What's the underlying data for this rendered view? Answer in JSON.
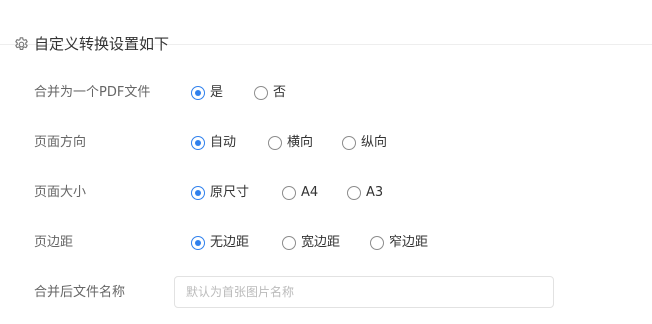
{
  "section": {
    "title": "自定义转换设置如下",
    "icon": "gear-icon"
  },
  "settings": {
    "merge": {
      "label": "合并为一个PDF文件",
      "options": [
        "是",
        "否"
      ],
      "selected": "是"
    },
    "orientation": {
      "label": "页面方向",
      "options": [
        "自动",
        "横向",
        "纵向"
      ],
      "selected": "自动"
    },
    "page_size": {
      "label": "页面大小",
      "options": [
        "原尺寸",
        "A4",
        "A3"
      ],
      "selected": "原尺寸"
    },
    "margin": {
      "label": "页边距",
      "options": [
        "无边距",
        "宽边距",
        "窄边距"
      ],
      "selected": "无边距"
    },
    "filename": {
      "label": "合并后文件名称",
      "value": "",
      "placeholder": "默认为首张图片名称"
    }
  },
  "colors": {
    "accent": "#2f80ed",
    "label_text": "#666666",
    "option_text": "#333333"
  }
}
